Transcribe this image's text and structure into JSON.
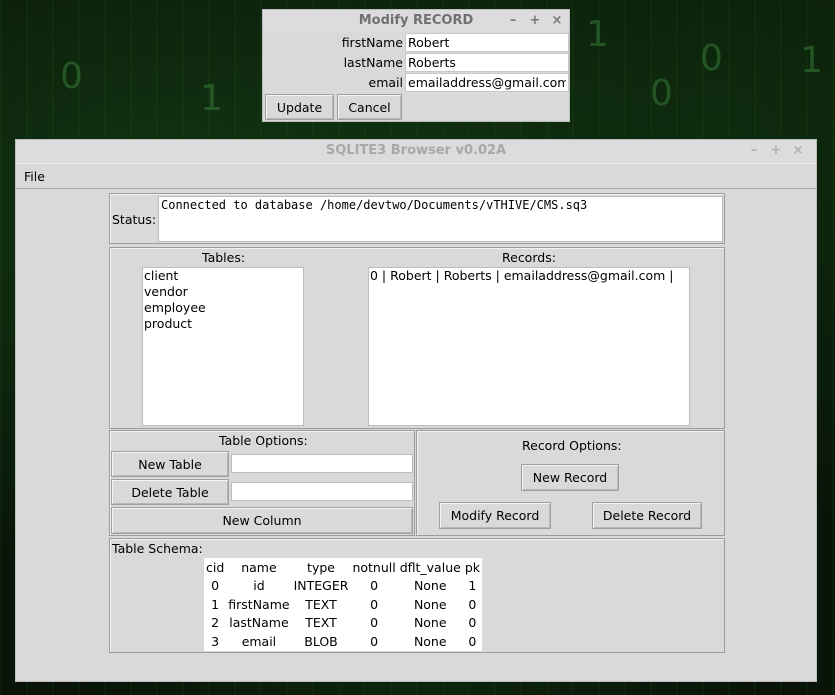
{
  "background": {
    "digits": [
      "1",
      "0",
      "1",
      "0",
      "1",
      "0",
      "1"
    ]
  },
  "modify_dialog": {
    "title": "Modify RECORD",
    "controls": {
      "minimize": "–",
      "maximize": "+",
      "close": "×"
    },
    "fields": [
      {
        "label": "firstName",
        "value": "Robert"
      },
      {
        "label": "lastName",
        "value": "Roberts"
      },
      {
        "label": "email",
        "value": "emailaddress@gmail.com"
      }
    ],
    "update_label": "Update",
    "cancel_label": "Cancel"
  },
  "main_window": {
    "title": "SQLITE3 Browser v0.02A",
    "controls": {
      "minimize": "–",
      "maximize": "+",
      "close": "×"
    },
    "menu": {
      "file": "File"
    },
    "status": {
      "label": "Status:",
      "text": "Connected to database /home/devtwo/Documents/vTHIVE/CMS.sq3"
    },
    "tables": {
      "label": "Tables:",
      "items": [
        "client",
        "vendor",
        "employee",
        "product"
      ]
    },
    "records": {
      "label": "Records:",
      "items": [
        "0 | Robert | Roberts | emailaddress@gmail.com |"
      ]
    },
    "table_options": {
      "label": "Table Options:",
      "new_table": "New Table",
      "delete_table": "Delete Table",
      "new_column": "New Column"
    },
    "record_options": {
      "label": "Record Options:",
      "new_record": "New Record",
      "modify_record": "Modify Record",
      "delete_record": "Delete Record"
    },
    "schema": {
      "label": "Table Schema:",
      "columns": [
        "cid",
        "name",
        "type",
        "notnull",
        "dflt_value",
        "pk"
      ],
      "rows": [
        [
          "0",
          "id",
          "INTEGER",
          "0",
          "None",
          "1"
        ],
        [
          "1",
          "firstName",
          "TEXT",
          "0",
          "None",
          "0"
        ],
        [
          "2",
          "lastName",
          "TEXT",
          "0",
          "None",
          "0"
        ],
        [
          "3",
          "email",
          "BLOB",
          "0",
          "None",
          "0"
        ]
      ]
    }
  }
}
